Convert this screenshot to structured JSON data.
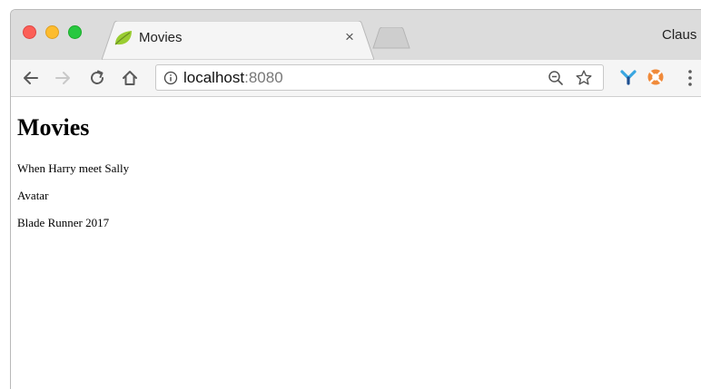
{
  "browser": {
    "tab": {
      "title": "Movies",
      "close_glyph": "×",
      "favicon": "spring-leaf-icon"
    },
    "profile_name": "Claus",
    "address": {
      "host": "localhost",
      "port": ":8080"
    },
    "toolbar_icons": [
      "back-arrow-icon",
      "forward-arrow-icon",
      "reload-icon",
      "home-icon",
      "info-icon",
      "zoom-out-icon",
      "bookmark-star-icon",
      "extension-y-icon",
      "extension-lifebuoy-icon",
      "kebab-menu-icon"
    ],
    "colors": {
      "tab_strip": "#dcdcdc",
      "toolbar": "#f5f5f5",
      "close_red": "#fc5f57",
      "minimize_yellow": "#fdbc2e",
      "zoom_green": "#28c840"
    }
  },
  "page": {
    "heading": "Movies",
    "movies": [
      "When Harry meet Sally",
      "Avatar",
      "Blade Runner 2017"
    ]
  }
}
